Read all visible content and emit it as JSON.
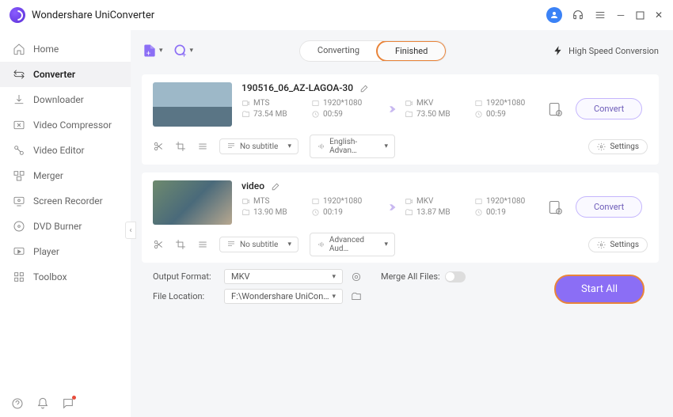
{
  "app": {
    "title": "Wondershare UniConverter"
  },
  "sidebar": {
    "items": [
      {
        "label": "Home"
      },
      {
        "label": "Converter"
      },
      {
        "label": "Downloader"
      },
      {
        "label": "Video Compressor"
      },
      {
        "label": "Video Editor"
      },
      {
        "label": "Merger"
      },
      {
        "label": "Screen Recorder"
      },
      {
        "label": "DVD Burner"
      },
      {
        "label": "Player"
      },
      {
        "label": "Toolbox"
      }
    ]
  },
  "tabs": {
    "converting": "Converting",
    "finished": "Finished"
  },
  "hsc": "High Speed Conversion",
  "items": [
    {
      "title": "190516_06_AZ-LAGOA-30",
      "in": {
        "fmt": "MTS",
        "res": "1920*1080",
        "size": "73.54 MB",
        "dur": "00:59"
      },
      "out": {
        "fmt": "MKV",
        "res": "1920*1080",
        "size": "73.50 MB",
        "dur": "00:59"
      },
      "subtitle": "No subtitle",
      "audio": "English-Advan…",
      "convert": "Convert",
      "settings": "Settings"
    },
    {
      "title": "video",
      "in": {
        "fmt": "MTS",
        "res": "1920*1080",
        "size": "13.90 MB",
        "dur": "00:19"
      },
      "out": {
        "fmt": "MKV",
        "res": "1920*1080",
        "size": "13.87 MB",
        "dur": "00:19"
      },
      "subtitle": "No subtitle",
      "audio": "Advanced Aud…",
      "convert": "Convert",
      "settings": "Settings"
    }
  ],
  "footer": {
    "outfmt_label": "Output Format:",
    "outfmt": "MKV",
    "loc_label": "File Location:",
    "loc": "F:\\Wondershare UniConverter",
    "merge": "Merge All Files:",
    "start": "Start All"
  }
}
